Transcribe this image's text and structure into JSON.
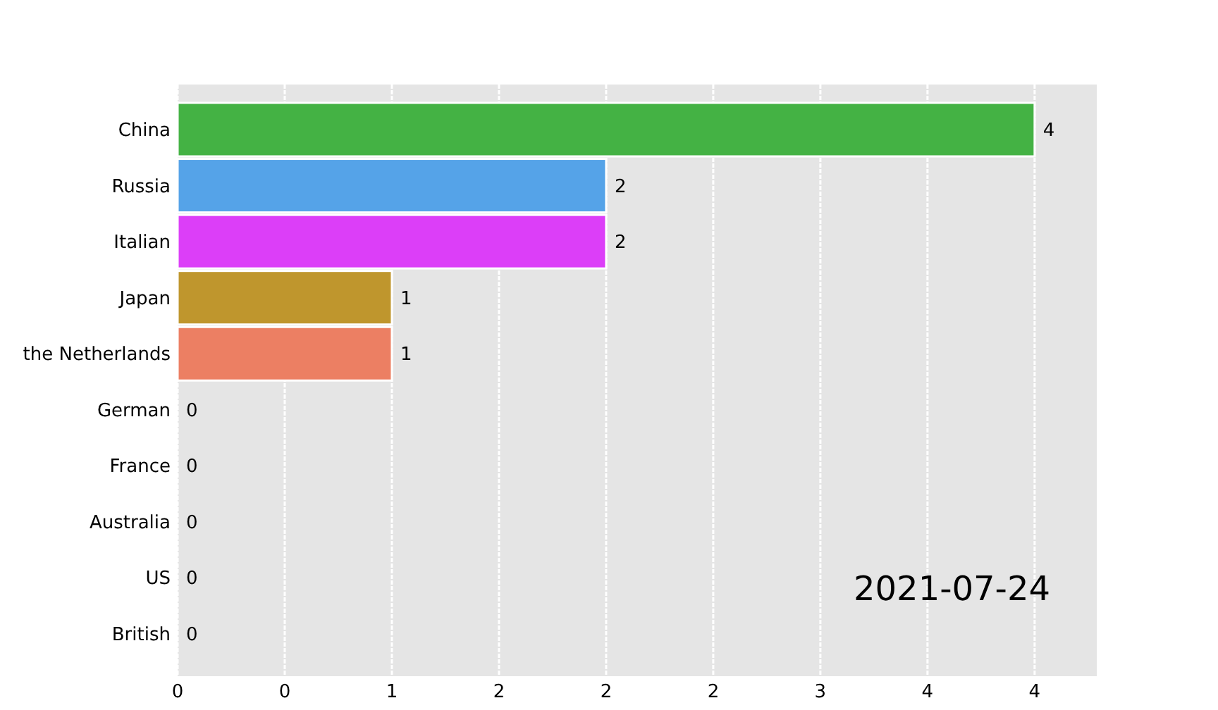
{
  "chart": {
    "chart_data": {
      "type": "bar",
      "orientation": "horizontal",
      "grid": true,
      "categories": [
        "China",
        "Russia",
        "Italian",
        "Japan",
        "the Netherlands",
        "German",
        "France",
        "Australia",
        "US",
        "British"
      ],
      "series": [
        {
          "values": [
            4,
            2,
            2,
            1,
            1,
            0,
            0,
            0,
            0,
            0
          ]
        }
      ],
      "colors": [
        "#44b244",
        "#55a3e8",
        "#dc3ef8",
        "#bf962d",
        "#ec7f63"
      ],
      "xlim": [
        0,
        4.29
      ],
      "xticks": [
        {
          "value": 0,
          "label": "0"
        },
        {
          "value": 0.5,
          "label": "0"
        },
        {
          "value": 1,
          "label": "1"
        },
        {
          "value": 1.5,
          "label": "2"
        },
        {
          "value": 2,
          "label": "2"
        },
        {
          "value": 2.5,
          "label": "2"
        },
        {
          "value": 3,
          "label": "3"
        },
        {
          "value": 3.5,
          "label": "4"
        },
        {
          "value": 4,
          "label": "4"
        }
      ],
      "data_labels": true,
      "annotations": [
        {
          "text": "2021-07-24"
        }
      ]
    }
  }
}
